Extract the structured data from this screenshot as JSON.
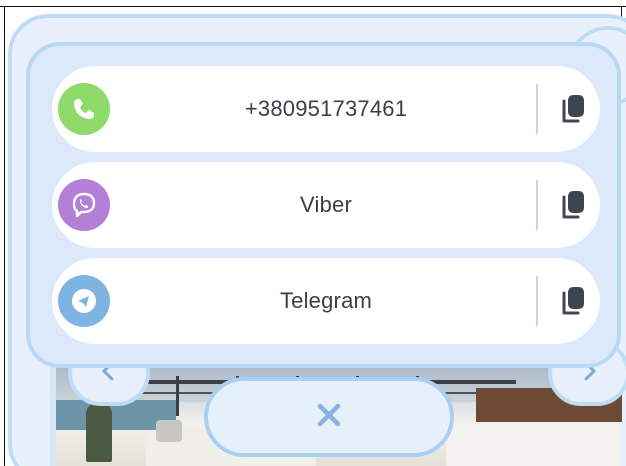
{
  "contacts": [
    {
      "type": "phone",
      "label": "+380951737461",
      "icon": "phone-icon",
      "color": "#8fdb6a"
    },
    {
      "type": "viber",
      "label": "Viber",
      "icon": "viber-icon",
      "color": "#b47fd6"
    },
    {
      "type": "telegram",
      "label": "Telegram",
      "icon": "telegram-icon",
      "color": "#7fb3e2"
    }
  ],
  "actions": {
    "copy_icon": "copy-icon",
    "close_icon": "close-icon"
  },
  "colors": {
    "panel_bg": "#dbe9fa",
    "panel_border": "#b9d8f6",
    "text": "#3a3f49",
    "copy_icon": "#3f4550",
    "close_icon": "#89b3dc"
  }
}
